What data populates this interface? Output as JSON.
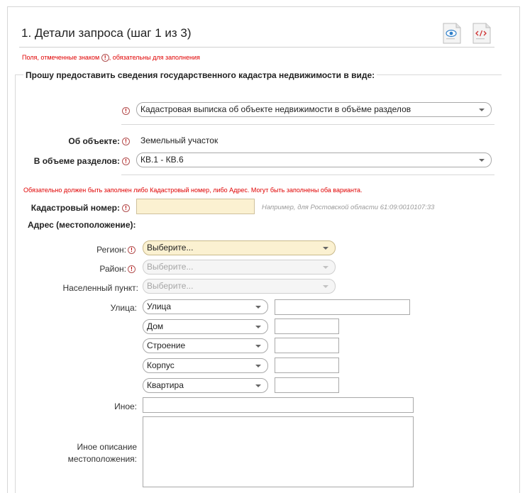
{
  "header": {
    "title": "1. Детали запроса (шаг 1 из 3)"
  },
  "required_note": {
    "before": "Поля, отмеченные знаком",
    "after": ", обязательны для заполнения"
  },
  "required_marker": "!",
  "section_legend": "Прошу предоставить сведения государственного кадастра недвижимости в виде:",
  "doc_type": {
    "value": "Кадастровая выписка об объекте недвижимости в объёме разделов"
  },
  "object": {
    "label": "Об объекте:",
    "value": "Земельный участок"
  },
  "sections": {
    "label": "В объеме разделов:",
    "value": "КВ.1 - КВ.6"
  },
  "error_notice": "Обязательно должен быть заполнен либо Кадастровый номер, либо Адрес. Могут быть заполнены оба варианта.",
  "cadastral": {
    "label": "Кадастровый номер:",
    "value": "",
    "hint": "Например, для Ростовской области 61:09:0010107:33"
  },
  "address": {
    "heading": "Адрес (местоположение):",
    "region_label": "Регион:",
    "region_value": "Выберите...",
    "district_label": "Район:",
    "district_value": "Выберите...",
    "locality_label": "Населенный пункт:",
    "locality_value": "Выберите...",
    "street_label": "Улица:",
    "street_type": "Улица",
    "house_type": "Дом",
    "building_type": "Строение",
    "block_type": "Корпус",
    "apartment_type": "Квартира",
    "other_label": "Иное:",
    "other_desc_label_1": "Иное описание",
    "other_desc_label_2": "местоположения:"
  },
  "colors": {
    "required_red": "#e00000",
    "field_yellow": "#fbf1d1",
    "border_gray": "#a9a9a9"
  }
}
